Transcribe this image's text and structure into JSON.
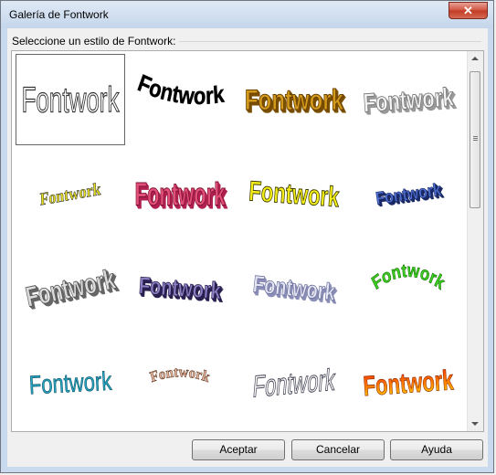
{
  "window": {
    "title": "Galería de Fontwork",
    "close_glyph": "✕"
  },
  "group": {
    "label": "Seleccione un estilo de Fontwork:"
  },
  "gallery": {
    "items": [
      {
        "text": "Fontwork",
        "style": "outline"
      },
      {
        "text": "Fontwork",
        "style": "black-wave"
      },
      {
        "text": "Fontwork",
        "style": "gold-3d"
      },
      {
        "text": "Fontwork",
        "style": "silver-3d"
      },
      {
        "text": "Fontwork",
        "style": "yellow-slant"
      },
      {
        "text": "Fontwork",
        "style": "pink-perspective"
      },
      {
        "text": "Fontwork",
        "style": "yellow-wave"
      },
      {
        "text": "Fontwork",
        "style": "blue-slant"
      },
      {
        "text": "Fontwork",
        "style": "grey-3d"
      },
      {
        "text": "Fontwork",
        "style": "purple-3d"
      },
      {
        "text": "Fontwork",
        "style": "lavender-3d"
      },
      {
        "text": "Fontwork",
        "style": "green-arch"
      },
      {
        "text": "Fontwork",
        "style": "teal-wave"
      },
      {
        "text": "Fontwork",
        "style": "brown-arch"
      },
      {
        "text": "Fontwork",
        "style": "outline-slant"
      },
      {
        "text": "Fontwork",
        "style": "fire-gradient"
      }
    ],
    "selected_index": 0
  },
  "buttons": {
    "ok": "Aceptar",
    "cancel": "Cancelar",
    "help": "Ayuda"
  },
  "colors": {
    "title_bar": "#c9daee",
    "close_button": "#c7412b"
  }
}
